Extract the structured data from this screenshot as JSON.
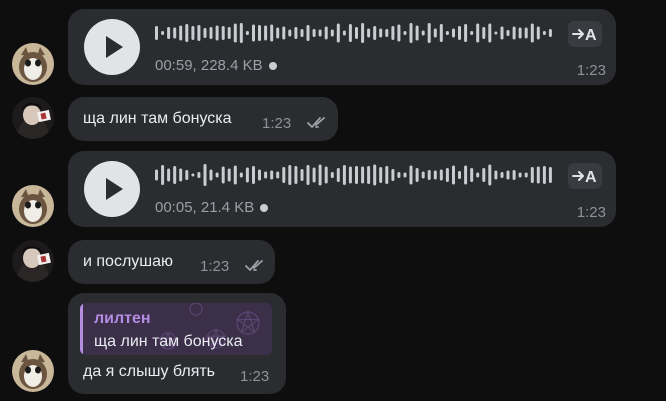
{
  "messages": [
    {
      "type": "voice",
      "duration": "00:59",
      "size": "228.4 KB",
      "meta": "00:59, 228.4 KB",
      "time": "1:23",
      "transcribe_icon": "arrow-to-A-transcribe-icon"
    },
    {
      "type": "text",
      "text": "ща лин там бонуска",
      "time": "1:23",
      "status_icon": "double-check-icon"
    },
    {
      "type": "voice",
      "duration": "00:05",
      "size": "21.4 KB",
      "meta": "00:05, 21.4 KB",
      "time": "1:23",
      "transcribe_icon": "arrow-to-A-transcribe-icon"
    },
    {
      "type": "text",
      "text": "и послушаю",
      "time": "1:23",
      "status_icon": "double-check-icon"
    },
    {
      "type": "reply",
      "quote_author": "лилтен",
      "quote_text": "ща лин там бонуска",
      "text": "да я слышу блять",
      "time": "1:23"
    }
  ],
  "colors": {
    "background": "#0e0e0f",
    "bubble": "#2b2c30",
    "play_button": "#e1e3e6",
    "waveform": "#c9cdd1",
    "meta_text": "#9aa0a6",
    "quote_accent": "#b48ce0",
    "quote_background": "#3b2f4a"
  }
}
